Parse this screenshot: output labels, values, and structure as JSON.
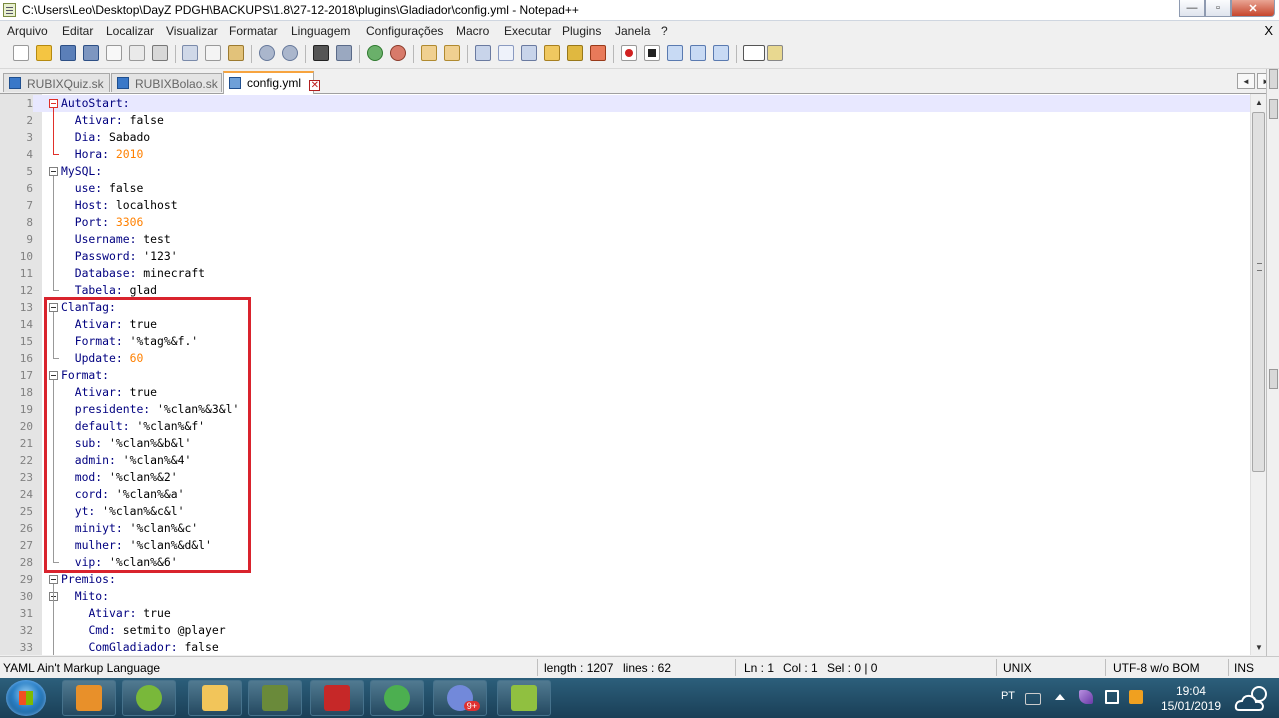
{
  "window": {
    "title": "C:\\Users\\Leo\\Desktop\\DayZ PDGH\\BACKUPS\\1.8\\27-12-2018\\plugins\\Gladiador\\config.yml - Notepad++",
    "min_glyph": "—",
    "max_glyph": "▫",
    "close_glyph": "✕"
  },
  "menu": {
    "items": [
      "Arquivo",
      "Editar",
      "Localizar",
      "Visualizar",
      "Formatar",
      "Linguagem",
      "Configurações",
      "Macro",
      "Executar",
      "Plugins",
      "Janela",
      "?"
    ],
    "close": "X"
  },
  "tabs": [
    {
      "label": "RUBIXQuiz.sk",
      "active": false
    },
    {
      "label": "RUBIXBolao.sk",
      "active": false
    },
    {
      "label": "config.yml",
      "active": true
    }
  ],
  "tab_close_glyph": "✕",
  "tab_arrows": [
    "◄",
    "►"
  ],
  "editor": {
    "lines": [
      {
        "n": "1",
        "indent": "",
        "key": "AutoStart:",
        "val": "",
        "kind": "key"
      },
      {
        "n": "2",
        "indent": "  ",
        "key": "Ativar:",
        "val": " false",
        "kind": "str"
      },
      {
        "n": "3",
        "indent": "  ",
        "key": "Dia:",
        "val": " Sabado",
        "kind": "str"
      },
      {
        "n": "4",
        "indent": "  ",
        "key": "Hora:",
        "val": " 2010",
        "kind": "num"
      },
      {
        "n": "5",
        "indent": "",
        "key": "MySQL:",
        "val": "",
        "kind": "key"
      },
      {
        "n": "6",
        "indent": "  ",
        "key": "use:",
        "val": " false",
        "kind": "str"
      },
      {
        "n": "7",
        "indent": "  ",
        "key": "Host:",
        "val": " localhost",
        "kind": "str"
      },
      {
        "n": "8",
        "indent": "  ",
        "key": "Port:",
        "val": " 3306",
        "kind": "num"
      },
      {
        "n": "9",
        "indent": "  ",
        "key": "Username:",
        "val": " test",
        "kind": "str"
      },
      {
        "n": "10",
        "indent": "  ",
        "key": "Password:",
        "val": " '123'",
        "kind": "str"
      },
      {
        "n": "11",
        "indent": "  ",
        "key": "Database:",
        "val": " minecraft",
        "kind": "str"
      },
      {
        "n": "12",
        "indent": "  ",
        "key": "Tabela:",
        "val": " glad",
        "kind": "str"
      },
      {
        "n": "13",
        "indent": "",
        "key": "ClanTag:",
        "val": "",
        "kind": "key"
      },
      {
        "n": "14",
        "indent": "  ",
        "key": "Ativar:",
        "val": " true",
        "kind": "str"
      },
      {
        "n": "15",
        "indent": "  ",
        "key": "Format:",
        "val": " '%tag%&f.'",
        "kind": "str"
      },
      {
        "n": "16",
        "indent": "  ",
        "key": "Update:",
        "val": " 60",
        "kind": "num"
      },
      {
        "n": "17",
        "indent": "",
        "key": "Format:",
        "val": "",
        "kind": "key"
      },
      {
        "n": "18",
        "indent": "  ",
        "key": "Ativar:",
        "val": " true",
        "kind": "str"
      },
      {
        "n": "19",
        "indent": "  ",
        "key": "presidente:",
        "val": " '%clan%&3&l'",
        "kind": "str"
      },
      {
        "n": "20",
        "indent": "  ",
        "key": "default:",
        "val": " '%clan%&f'",
        "kind": "str"
      },
      {
        "n": "21",
        "indent": "  ",
        "key": "sub:",
        "val": " '%clan%&b&l'",
        "kind": "str"
      },
      {
        "n": "22",
        "indent": "  ",
        "key": "admin:",
        "val": " '%clan%&4'",
        "kind": "str"
      },
      {
        "n": "23",
        "indent": "  ",
        "key": "mod:",
        "val": " '%clan%&2'",
        "kind": "str"
      },
      {
        "n": "24",
        "indent": "  ",
        "key": "cord:",
        "val": " '%clan%&a'",
        "kind": "str"
      },
      {
        "n": "25",
        "indent": "  ",
        "key": "yt:",
        "val": " '%clan%&c&l'",
        "kind": "str"
      },
      {
        "n": "26",
        "indent": "  ",
        "key": "miniyt:",
        "val": " '%clan%&c'",
        "kind": "str"
      },
      {
        "n": "27",
        "indent": "  ",
        "key": "mulher:",
        "val": " '%clan%&d&l'",
        "kind": "str"
      },
      {
        "n": "28",
        "indent": "  ",
        "key": "vip:",
        "val": " '%clan%&6'",
        "kind": "str"
      },
      {
        "n": "29",
        "indent": "",
        "key": "Premios:",
        "val": "",
        "kind": "key"
      },
      {
        "n": "30",
        "indent": "  ",
        "key": "Mito:",
        "val": "",
        "kind": "key"
      },
      {
        "n": "31",
        "indent": "    ",
        "key": "Ativar:",
        "val": " true",
        "kind": "str"
      },
      {
        "n": "32",
        "indent": "    ",
        "key": "Cmd:",
        "val": " setmito @player",
        "kind": "str"
      },
      {
        "n": "33",
        "indent": "    ",
        "key": "ComGladiador:",
        "val": " false",
        "kind": "str"
      }
    ]
  },
  "scrollbar": {
    "up_glyph": "▲",
    "down_glyph": "▼"
  },
  "status": {
    "lang": "YAML Ain't Markup Language",
    "length": "length : 1207",
    "lines": "lines : 62",
    "ln": "Ln : 1",
    "col": "Col : 1",
    "sel": "Sel : 0 | 0",
    "eol": "UNIX",
    "encoding": "UTF-8 w/o BOM",
    "mode": "INS"
  },
  "taskbar": {
    "lang": "PT",
    "time": "19:04",
    "date": "15/01/2019",
    "apps": [
      {
        "name": "media-player",
        "color": "#e8902a"
      },
      {
        "name": "utorrent",
        "color": "#79b83a"
      },
      {
        "name": "explorer",
        "color": "#f2c55a"
      },
      {
        "name": "minecraft",
        "color": "#6a8a3a"
      },
      {
        "name": "filezilla",
        "color": "#c62828"
      },
      {
        "name": "chrome",
        "color": "#4caf50"
      },
      {
        "name": "discord",
        "color": "#7289da"
      },
      {
        "name": "notepad-plus-plus",
        "color": "#90c040"
      }
    ],
    "discord_badge": "9+"
  }
}
